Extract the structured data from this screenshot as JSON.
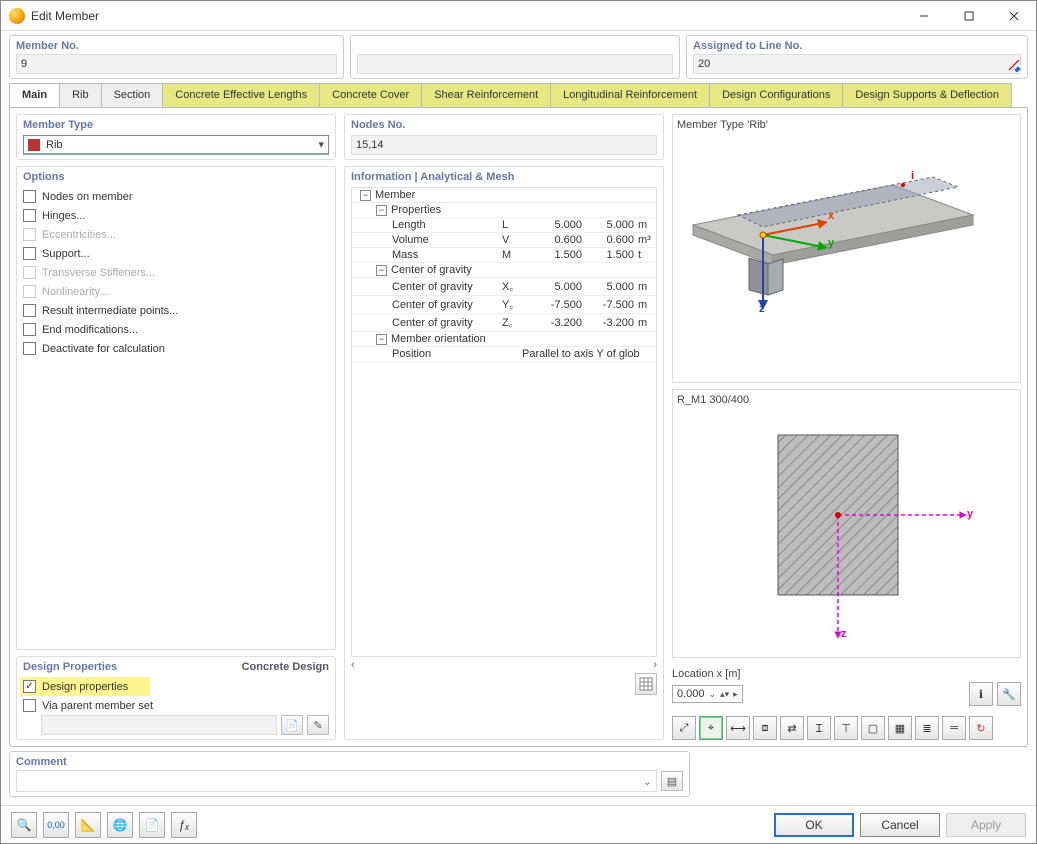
{
  "window": {
    "title": "Edit Member"
  },
  "top": {
    "member_no_label": "Member No.",
    "member_no_value": "9",
    "assigned_label": "Assigned to Line No.",
    "assigned_value": "20"
  },
  "tabs": [
    {
      "label": "Main",
      "active": true
    },
    {
      "label": "Rib"
    },
    {
      "label": "Section"
    },
    {
      "label": "Concrete Effective Lengths",
      "hl": true
    },
    {
      "label": "Concrete Cover",
      "hl": true
    },
    {
      "label": "Shear Reinforcement",
      "hl": true
    },
    {
      "label": "Longitudinal Reinforcement",
      "hl": true
    },
    {
      "label": "Design Configurations",
      "hl": true
    },
    {
      "label": "Design Supports & Deflection",
      "hl": true
    }
  ],
  "member_type": {
    "title": "Member Type",
    "value": "Rib"
  },
  "options": {
    "title": "Options",
    "items": [
      {
        "label": "Nodes on member",
        "checked": false
      },
      {
        "label": "Hinges...",
        "checked": false
      },
      {
        "label": "Eccentricities...",
        "checked": false,
        "disabled": true
      },
      {
        "label": "Support...",
        "checked": false
      },
      {
        "label": "Transverse Stiffeners...",
        "checked": false,
        "disabled": true
      },
      {
        "label": "Nonlinearity...",
        "checked": false,
        "disabled": true
      },
      {
        "label": "Result intermediate points...",
        "checked": false
      },
      {
        "label": "End modifications...",
        "checked": false
      },
      {
        "label": "Deactivate for calculation",
        "checked": false
      }
    ]
  },
  "design_props": {
    "title": "Design Properties",
    "right_link": "Concrete Design",
    "rows": [
      {
        "label": "Design properties",
        "checked": true,
        "hl": true
      },
      {
        "label": "Via parent member set",
        "checked": false
      }
    ]
  },
  "nodes": {
    "title": "Nodes No.",
    "value": "15,14"
  },
  "info": {
    "title": "Information | Analytical & Mesh",
    "member": "Member",
    "properties": "Properties",
    "rows": [
      {
        "name": "Length",
        "sym": "L",
        "v1": "5.000",
        "v2": "5.000",
        "u": "m"
      },
      {
        "name": "Volume",
        "sym": "V",
        "v1": "0.600",
        "v2": "0.600",
        "u": "m³"
      },
      {
        "name": "Mass",
        "sym": "M",
        "v1": "1.500",
        "v2": "1.500",
        "u": "t"
      }
    ],
    "cog_header": "Center of gravity",
    "cog": [
      {
        "name": "Center of gravity",
        "sym": "X꜀",
        "v1": "5.000",
        "v2": "5.000",
        "u": "m"
      },
      {
        "name": "Center of gravity",
        "sym": "Y꜀",
        "v1": "-7.500",
        "v2": "-7.500",
        "u": "m"
      },
      {
        "name": "Center of gravity",
        "sym": "Z꜀",
        "v1": "-3.200",
        "v2": "-3.200",
        "u": "m"
      }
    ],
    "orient_header": "Member orientation",
    "position_label": "Position",
    "position_value": "Parallel to axis Y of glob"
  },
  "right": {
    "preview_title": "Member Type 'Rib'",
    "axes": {
      "x": "x",
      "y": "y",
      "z": "z",
      "i": "i"
    },
    "section_title": "R_M1 300/400",
    "location_label": "Location x [m]",
    "location_value": "0.000"
  },
  "comment": {
    "title": "Comment"
  },
  "footer": {
    "ok": "OK",
    "cancel": "Cancel",
    "apply": "Apply"
  }
}
